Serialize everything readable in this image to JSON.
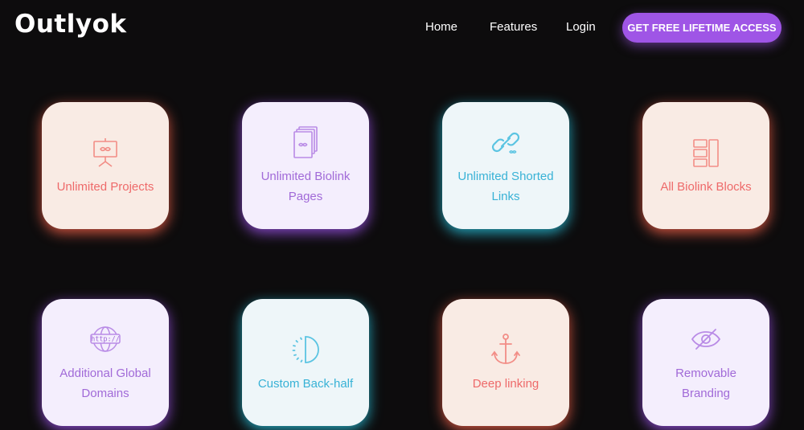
{
  "header": {
    "logo": "Outlyok",
    "nav": [
      "Home",
      "Features",
      "Login"
    ],
    "cta": "GET FREE LIFETIME ACCESS"
  },
  "colors": {
    "background": "#0d0c0d",
    "cta": "#9f55e6",
    "orange_accent": "#ee6a6a",
    "purple_accent": "#a16ad8",
    "cyan_accent": "#38b2d6"
  },
  "features": [
    {
      "label": "Unlimited Projects",
      "icon": "presentation-board-icon",
      "theme": "orange"
    },
    {
      "label": "Unlimited Biolink Pages",
      "icon": "stacked-pages-icon",
      "theme": "purple"
    },
    {
      "label": "Unlimited Shorted Links",
      "icon": "link-chain-icon",
      "theme": "cyan"
    },
    {
      "label": "All Biolink Blocks",
      "icon": "blocks-layout-icon",
      "theme": "orange"
    },
    {
      "label": "Additional Global Domains",
      "icon": "globe-http-icon",
      "theme": "purple"
    },
    {
      "label": "Custom Back-half",
      "icon": "half-circle-icon",
      "theme": "cyan"
    },
    {
      "label": "Deep linking",
      "icon": "anchor-icon",
      "theme": "orange"
    },
    {
      "label": "Removable Branding",
      "icon": "eye-off-icon",
      "theme": "purple"
    }
  ]
}
